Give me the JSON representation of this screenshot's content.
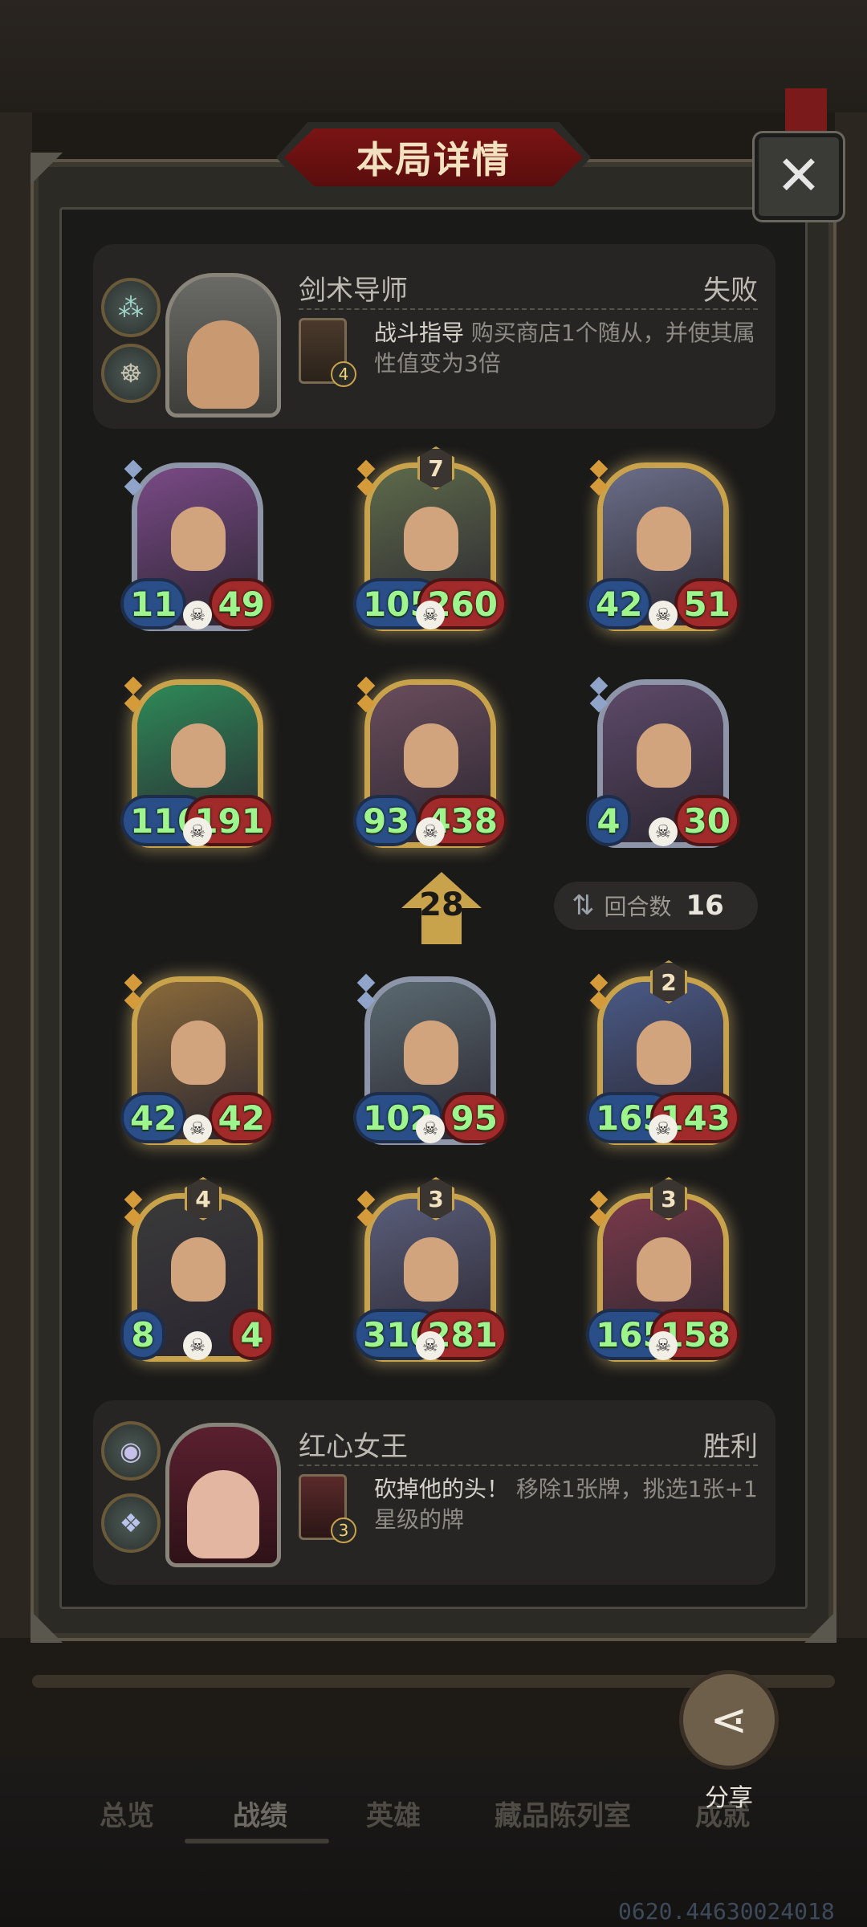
{
  "title": "本局详情",
  "close_icon": "close-icon",
  "player_top": {
    "name": "剑术导师",
    "result": "失败",
    "skill_level": "4",
    "skill_name": "战斗指导",
    "skill_desc": "购买商店1个随从，并使其属性值变为3倍"
  },
  "player_bottom": {
    "name": "红心女王",
    "result": "胜利",
    "skill_level": "3",
    "skill_name": "砍掉他的头！",
    "skill_desc": "移除1张牌，挑选1张+1星级的牌"
  },
  "top_board": [
    {
      "atk": "11",
      "hp": "49",
      "star": "",
      "frame": "silver"
    },
    {
      "atk": "105",
      "hp": "260",
      "star": "7",
      "frame": "gold"
    },
    {
      "atk": "42",
      "hp": "51",
      "star": "",
      "frame": "gold"
    },
    {
      "atk": "116",
      "hp": "191",
      "star": "",
      "frame": "gold"
    },
    {
      "atk": "93",
      "hp": "438",
      "star": "",
      "frame": "gold"
    },
    {
      "atk": "4",
      "hp": "30",
      "star": "",
      "frame": "silver"
    }
  ],
  "bottom_board": [
    {
      "atk": "42",
      "hp": "42",
      "star": "",
      "frame": "gold"
    },
    {
      "atk": "102",
      "hp": "95",
      "star": "",
      "frame": "silver"
    },
    {
      "atk": "165",
      "hp": "143",
      "star": "2",
      "frame": "gold"
    },
    {
      "atk": "8",
      "hp": "4",
      "star": "4",
      "frame": "gold"
    },
    {
      "atk": "310",
      "hp": "281",
      "star": "3",
      "frame": "gold"
    },
    {
      "atk": "165",
      "hp": "158",
      "star": "3",
      "frame": "gold"
    }
  ],
  "turn_value": "28",
  "round": {
    "label": "回合数",
    "value": "16"
  },
  "share_label": "分享",
  "nav": [
    "总览",
    "战绩",
    "英雄",
    "藏品陈列室",
    "成就"
  ],
  "watermark": "0620.44630024018"
}
